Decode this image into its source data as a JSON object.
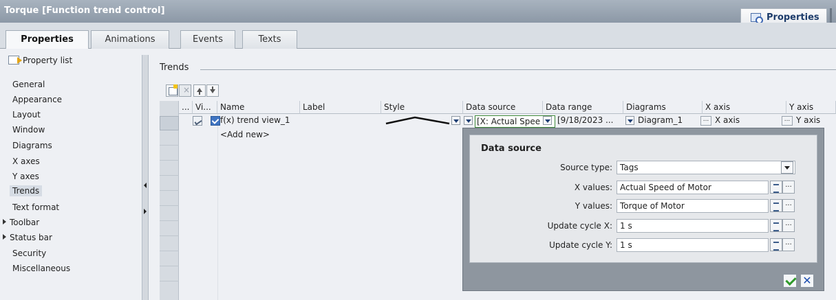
{
  "window": {
    "title": "Torque [Function trend control]",
    "properties_button": "Properties"
  },
  "tabs": [
    {
      "label": "Properties"
    },
    {
      "label": "Animations"
    },
    {
      "label": "Events"
    },
    {
      "label": "Texts"
    }
  ],
  "sidebar": {
    "header": "Property list",
    "items": [
      {
        "label": "General"
      },
      {
        "label": "Appearance"
      },
      {
        "label": "Layout"
      },
      {
        "label": "Window"
      },
      {
        "label": "Diagrams"
      },
      {
        "label": "X axes"
      },
      {
        "label": "Y axes"
      },
      {
        "label": "Trends"
      },
      {
        "label": "Text format"
      },
      {
        "label": "Toolbar"
      },
      {
        "label": "Status bar"
      },
      {
        "label": "Security"
      },
      {
        "label": "Miscellaneous"
      }
    ]
  },
  "section": {
    "title": "Trends"
  },
  "table": {
    "columns": [
      "...",
      "Vi...",
      "Name",
      "Label",
      "Style",
      "Data source",
      "Data range",
      "Diagrams",
      "X axis",
      "Y axis"
    ],
    "row": {
      "name": "f(x) trend view_1",
      "label": "",
      "data_source": "[X: Actual Spee",
      "data_range": "[9/18/2023 ...",
      "diagram": "Diagram_1",
      "x_axis": "X axis",
      "y_axis": "Y axis",
      "ellipsis": "..."
    },
    "add_new": "<Add new>"
  },
  "popup": {
    "title": "Data source",
    "fields": {
      "source_type_label": "Source type:",
      "source_type_value": "Tags",
      "x_values_label": "X values:",
      "x_values_value": "Actual Speed of Motor",
      "y_values_label": "Y values:",
      "y_values_value": "Torque of Motor",
      "update_x_label": "Update cycle X:",
      "update_x_value": "1 s",
      "update_y_label": "Update cycle Y:",
      "update_y_value": "1 s"
    },
    "ellipsis": "..."
  }
}
